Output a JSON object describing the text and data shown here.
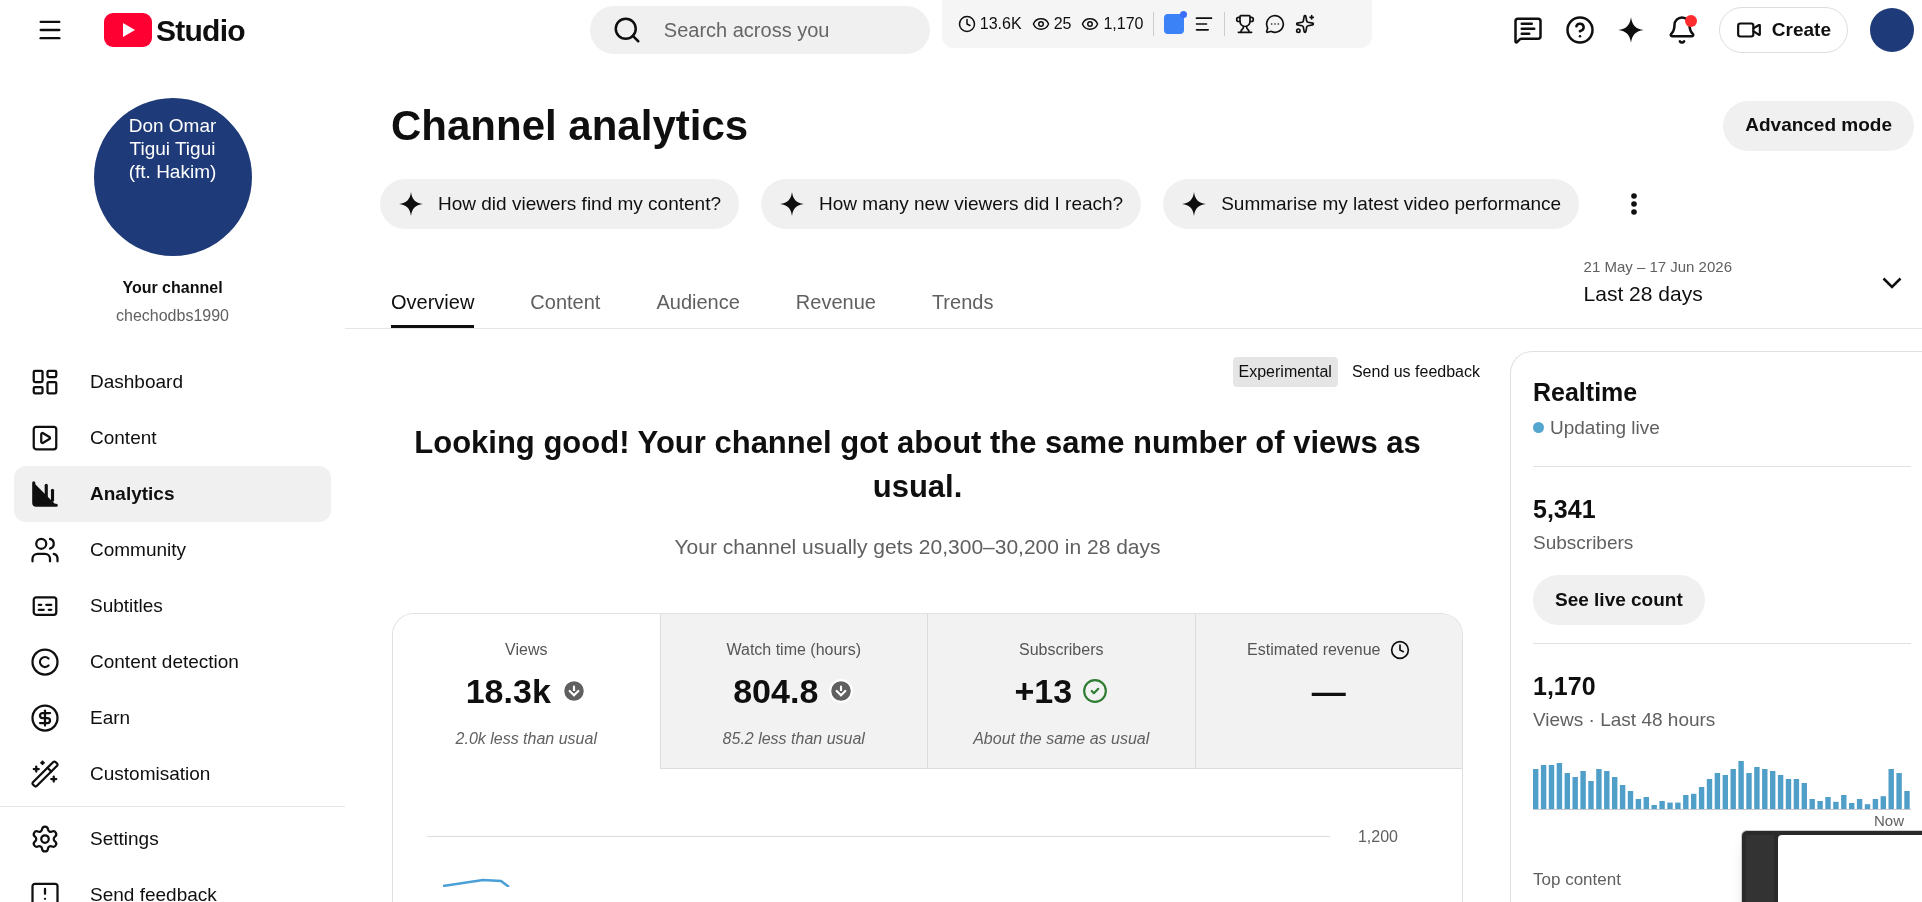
{
  "topbar": {
    "logo_text": "Studio",
    "search": {
      "placeholder": "Search across you"
    },
    "stats": [
      "13.6K",
      "25",
      "1,170"
    ],
    "notifications_badge": true,
    "create_label": "Create"
  },
  "sidebar": {
    "avatar_text": "Don Omar Tigui Tigui (ft. Hakim)",
    "channel_title": "Your channel",
    "channel_handle": "chechodbs1990",
    "items": [
      {
        "label": "Dashboard",
        "selected": false
      },
      {
        "label": "Content",
        "selected": false
      },
      {
        "label": "Analytics",
        "selected": true
      },
      {
        "label": "Community",
        "selected": false
      },
      {
        "label": "Subtitles",
        "selected": false
      },
      {
        "label": "Content detection",
        "selected": false
      },
      {
        "label": "Earn",
        "selected": false
      },
      {
        "label": "Customisation",
        "selected": false
      }
    ],
    "bottom_items": [
      {
        "label": "Settings",
        "selected": false
      },
      {
        "label": "Send feedback",
        "selected": false
      }
    ]
  },
  "page": {
    "title": "Channel analytics",
    "advanced_button": "Advanced mode",
    "suggestions": [
      "How did viewers find my content?",
      "How many new viewers did I reach?",
      "Summarise my latest video performance"
    ],
    "tabs": [
      {
        "label": "Overview",
        "selected": true
      },
      {
        "label": "Content",
        "selected": false
      },
      {
        "label": "Audience",
        "selected": false
      },
      {
        "label": "Revenue",
        "selected": false
      },
      {
        "label": "Trends",
        "selected": false
      }
    ],
    "date_range": {
      "dates": "21 May – 17 Jun 2026",
      "label": "Last 28 days"
    }
  },
  "overview": {
    "badge": "Experimental",
    "feedback_link": "Send us feedback",
    "headline": "Looking good! Your channel got about the same number of views as usual.",
    "subtitle": "Your channel usually gets 20,300–30,200 in 28 days",
    "metrics": [
      {
        "label": "Views",
        "value": "18.3k",
        "kind": "down",
        "note": "2.0k less than usual",
        "selected": true
      },
      {
        "label": "Watch time (hours)",
        "value": "804.8",
        "kind": "down",
        "note": "85.2 less than usual",
        "selected": false
      },
      {
        "label": "Subscribers",
        "value": "+13",
        "kind": "same",
        "note": "About the same as usual",
        "selected": false
      },
      {
        "label": "Estimated revenue",
        "value": "—",
        "kind": "pending",
        "selected": false
      }
    ],
    "chart_gridline_label": "1,200"
  },
  "realtime": {
    "title": "Realtime",
    "live_label": "Updating live",
    "subscribers_value": "5,341",
    "subscribers_label": "Subscribers",
    "live_count_button": "See live count",
    "views_value": "1,170",
    "views_label": "Views · Last 48 hours",
    "chart_end_label": "Now",
    "top_content_label": "Top content"
  }
}
